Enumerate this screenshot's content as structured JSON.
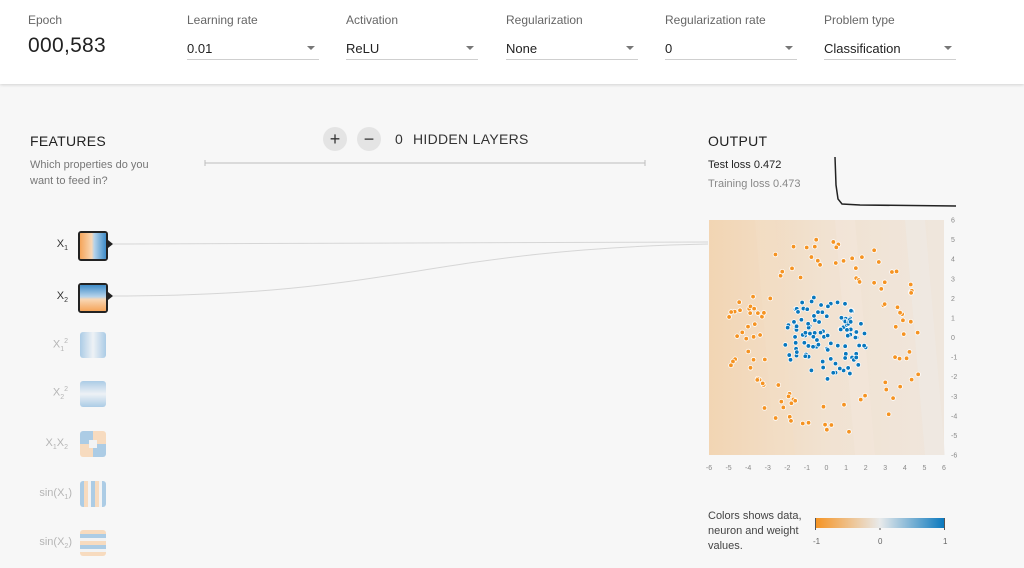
{
  "controls": {
    "epoch": {
      "label": "Epoch",
      "value": "000,583"
    },
    "learning_rate": {
      "label": "Learning rate",
      "value": "0.01"
    },
    "activation": {
      "label": "Activation",
      "value": "ReLU"
    },
    "regularization": {
      "label": "Regularization",
      "value": "None"
    },
    "regularization_rate": {
      "label": "Regularization rate",
      "value": "0"
    },
    "problem_type": {
      "label": "Problem type",
      "value": "Classification"
    }
  },
  "features": {
    "title": "FEATURES",
    "subtitle": "Which properties do you want to feed in?",
    "items": [
      {
        "label_main": "X",
        "label_sub": "1",
        "active": true
      },
      {
        "label_main": "X",
        "label_sub": "2",
        "active": true
      },
      {
        "label_main": "X",
        "label_sub": "1",
        "label_sup": "2",
        "active": false
      },
      {
        "label_main": "X",
        "label_sub": "2",
        "label_sup": "2",
        "active": false
      },
      {
        "label_main": "X",
        "label_sub": "1",
        "label_main2": "X",
        "label_sub2": "2",
        "active": false
      },
      {
        "label_pre": "sin(X",
        "label_sub": "1",
        "label_post": ")",
        "active": false
      },
      {
        "label_pre": "sin(X",
        "label_sub": "2",
        "label_post": ")",
        "active": false
      }
    ]
  },
  "hidden_layers": {
    "add": "+",
    "remove": "−",
    "count": "0",
    "label": "HIDDEN LAYERS"
  },
  "output": {
    "title": "OUTPUT",
    "test_loss": "Test loss 0.472",
    "training_loss": "Training loss 0.473",
    "axis_ticks": [
      "-6",
      "-5",
      "-4",
      "-3",
      "-2",
      "-1",
      "0",
      "1",
      "2",
      "3",
      "4",
      "5",
      "6"
    ]
  },
  "legend": {
    "text": "Colors shows data, neuron and weight values.",
    "ticks": [
      "-1",
      "0",
      "1"
    ]
  },
  "colors": {
    "orange": "#f59322",
    "blue": "#0877bd",
    "light": "#e8eaeb"
  }
}
